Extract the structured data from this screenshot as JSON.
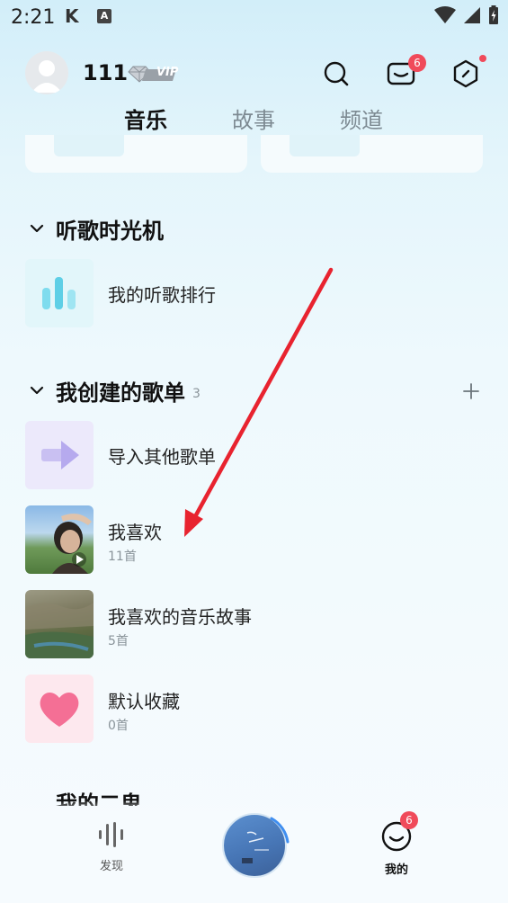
{
  "status": {
    "time": "2:21",
    "k_label": "K",
    "a_label": "A"
  },
  "profile": {
    "username": "111",
    "vip_label": "VIP",
    "mail_badge": "6"
  },
  "tabs": [
    {
      "label": "音乐",
      "active": true
    },
    {
      "label": "故事",
      "active": false
    },
    {
      "label": "频道",
      "active": false
    }
  ],
  "sections": {
    "time_machine": {
      "title": "听歌时光机",
      "items": [
        {
          "title": "我的听歌排行"
        }
      ]
    },
    "created_playlists": {
      "title": "我创建的歌单",
      "count": "3",
      "items": [
        {
          "title": "导入其他歌单",
          "sub": ""
        },
        {
          "title": "我喜欢",
          "sub": "11首"
        },
        {
          "title": "我喜欢的音乐故事",
          "sub": "5首"
        },
        {
          "title": "默认收藏",
          "sub": "0首"
        }
      ]
    },
    "my_other": {
      "title": "我的二鬼"
    }
  },
  "bottom_nav": {
    "discover_label": "发现",
    "mine_label": "我的",
    "mine_badge": "6"
  },
  "colors": {
    "accent_red": "#e8232f",
    "badge_red": "#f04a5a"
  }
}
